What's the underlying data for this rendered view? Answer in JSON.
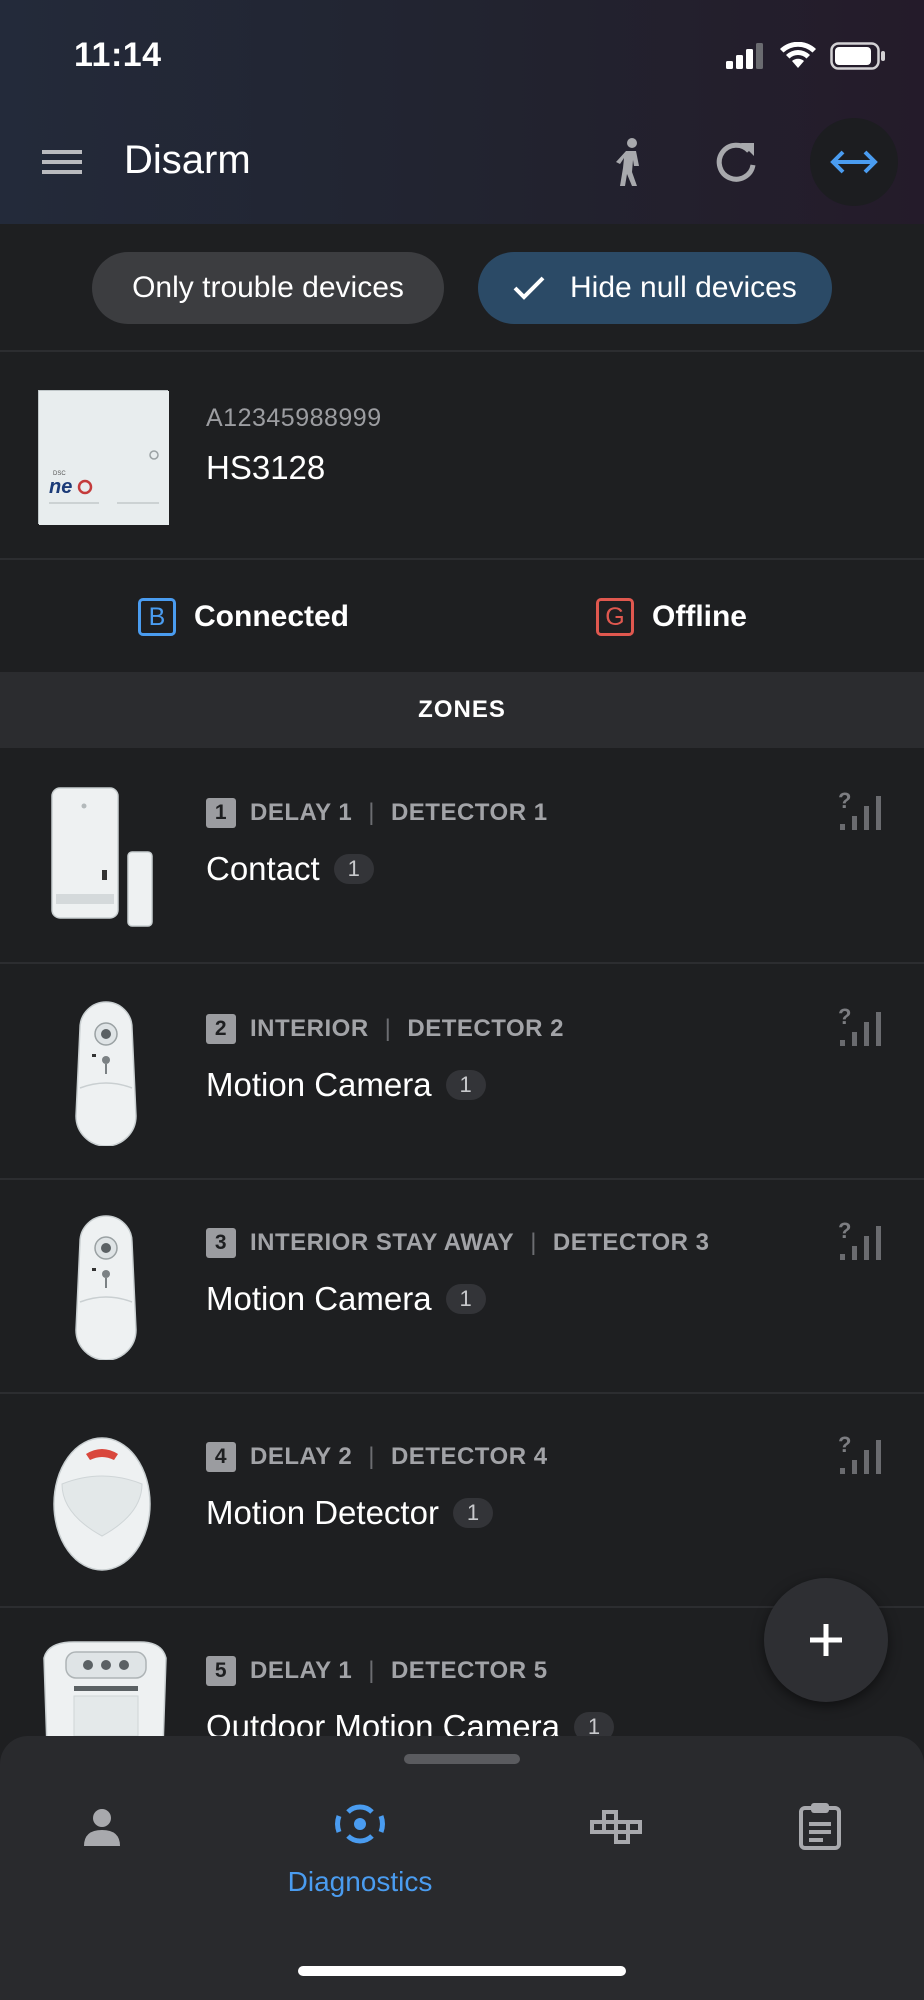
{
  "status_bar": {
    "time": "11:14",
    "icons": [
      "cellular-signal-icon",
      "wifi-icon",
      "battery-icon"
    ]
  },
  "header": {
    "title": "Disarm",
    "icons": [
      "menu-icon",
      "walking-person-icon",
      "refresh-icon",
      "swap-horizontal-icon"
    ],
    "accent_color": "#4a9cf0"
  },
  "filters": {
    "trouble_label": "Only trouble devices",
    "hide_null_label": "Hide null devices",
    "hide_null_checked": true
  },
  "panel": {
    "serial": "A12345988999",
    "model": "HS3128"
  },
  "connections": [
    {
      "badge": "B",
      "label": "Connected",
      "color": "#4a9cf0"
    },
    {
      "badge": "G",
      "label": "Offline",
      "color": "#e0584f"
    }
  ],
  "zones_header": "ZONES",
  "zones": [
    {
      "number": "1",
      "type": "DELAY 1",
      "detector": "DETECTOR 1",
      "name": "Contact",
      "count": "1",
      "device": "contact-sensor-icon"
    },
    {
      "number": "2",
      "type": "INTERIOR",
      "detector": "DETECTOR 2",
      "name": "Motion Camera",
      "count": "1",
      "device": "motion-camera-icon"
    },
    {
      "number": "3",
      "type": "INTERIOR STAY AWAY",
      "detector": "DETECTOR 3",
      "name": "Motion Camera",
      "count": "1",
      "device": "motion-camera-icon"
    },
    {
      "number": "4",
      "type": "DELAY 2",
      "detector": "DETECTOR 4",
      "name": "Motion Detector",
      "count": "1",
      "device": "motion-detector-icon"
    },
    {
      "number": "5",
      "type": "DELAY 1",
      "detector": "DETECTOR 5",
      "name": "Outdoor Motion Camera",
      "count": "1",
      "device": "outdoor-motion-camera-icon"
    }
  ],
  "signal_unknown_glyph": "?",
  "fab_icon": "plus-icon",
  "bottom_nav": [
    {
      "label": "",
      "icon": "person-icon",
      "active": false
    },
    {
      "label": "Diagnostics",
      "icon": "diagnostics-icon",
      "active": true
    },
    {
      "label": "",
      "icon": "floor-plan-icon",
      "active": false
    },
    {
      "label": "",
      "icon": "clipboard-icon",
      "active": false
    }
  ]
}
